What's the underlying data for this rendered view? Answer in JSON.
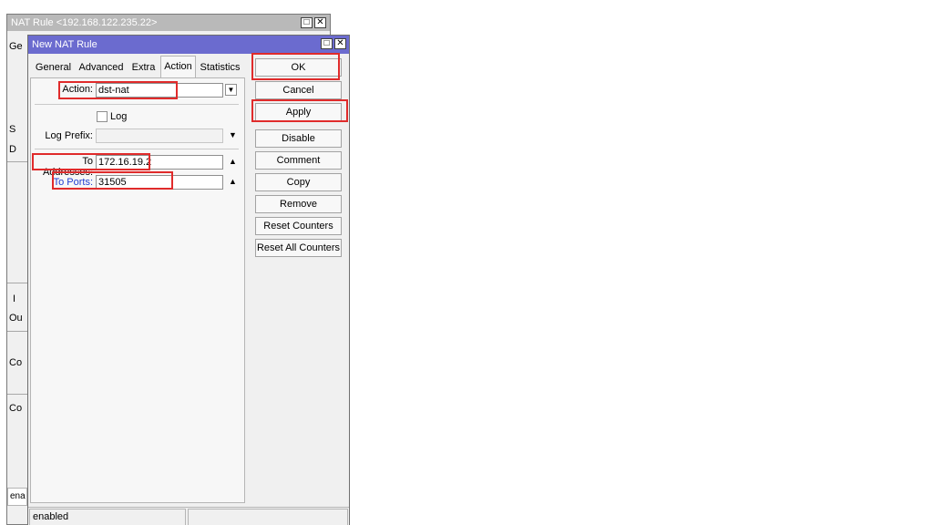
{
  "background_window": {
    "title": "NAT Rule <192.168.122.235.22>",
    "fragments": [
      "Ge",
      "S",
      "D",
      "I",
      "Ou",
      "Co",
      "Co"
    ],
    "status_text": "ena"
  },
  "dialog": {
    "title": "New NAT Rule",
    "tabs": [
      {
        "label": "General"
      },
      {
        "label": "Advanced"
      },
      {
        "label": "Extra"
      },
      {
        "label": "Action"
      },
      {
        "label": "Statistics"
      }
    ],
    "active_tab": "Action",
    "fields": {
      "action": {
        "label": "Action:",
        "value": "dst-nat"
      },
      "log": {
        "label": "Log",
        "checked": false
      },
      "log_prefix": {
        "label": "Log Prefix:",
        "value": ""
      },
      "to_addresses": {
        "label": "To Addresses:",
        "value": "172.16.19.2"
      },
      "to_ports": {
        "label": "To Ports:",
        "value": "31505"
      }
    },
    "buttons": {
      "ok": "OK",
      "cancel": "Cancel",
      "apply": "Apply",
      "disable": "Disable",
      "comment": "Comment",
      "copy": "Copy",
      "remove": "Remove",
      "reset_counters": "Reset Counters",
      "reset_all_counters": "Reset All Counters"
    },
    "status": "enabled"
  },
  "icons": {
    "restore": "restore-icon",
    "close": "close-icon",
    "dropdown": "dropdown-arrow-icon",
    "triangle_down": "triangle-down-icon",
    "triangle_up": "triangle-up-icon"
  },
  "colors": {
    "title_active": "#6b6bcf",
    "title_inactive": "#b9b9b9",
    "highlight": "#e02b2b",
    "link_blue": "#1f3dd1"
  }
}
